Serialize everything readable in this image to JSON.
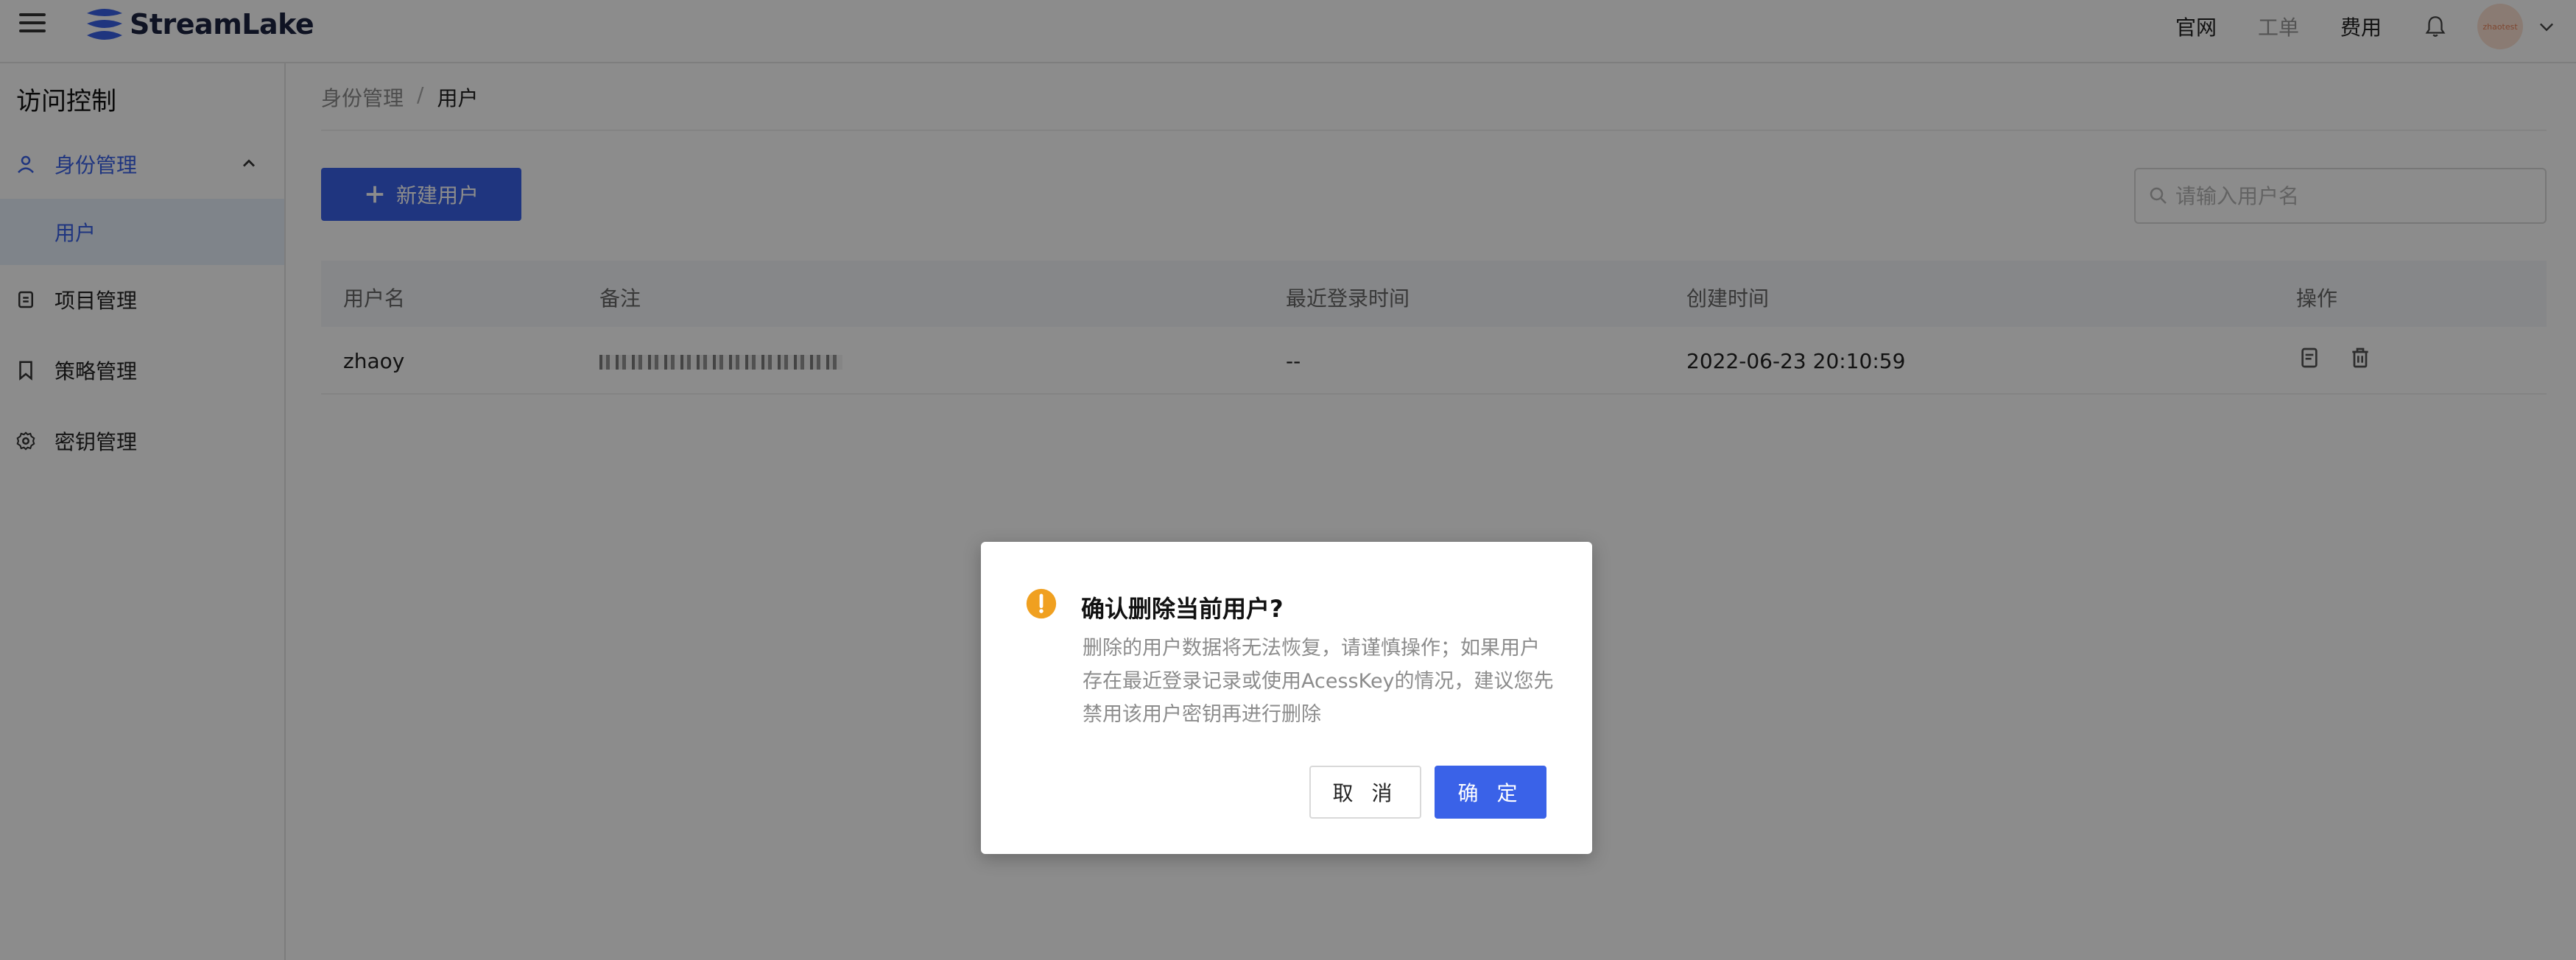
{
  "header": {
    "brand": "StreamLake",
    "nav": {
      "official": "官网",
      "ticket": "工单",
      "billing": "费用"
    },
    "avatar_text": "zhaotest"
  },
  "sidebar": {
    "title": "访问控制",
    "items": [
      {
        "label": "身份管理",
        "icon": "user-icon"
      },
      {
        "label": "用户"
      },
      {
        "label": "项目管理",
        "icon": "document-icon"
      },
      {
        "label": "策略管理",
        "icon": "bookmark-icon"
      },
      {
        "label": "密钥管理",
        "icon": "gear-icon"
      }
    ]
  },
  "breadcrumb": {
    "parent": "身份管理",
    "sep": "/",
    "current": "用户"
  },
  "toolbar": {
    "new_user": "新建用户",
    "search_placeholder": "请输入用户名"
  },
  "table": {
    "columns": [
      "用户名",
      "备注",
      "最近登录时间",
      "创建时间",
      "操作"
    ],
    "rows": [
      {
        "username": "zhaoy",
        "remark": "",
        "last_login": "--",
        "created": "2022-06-23 20:10:59"
      }
    ]
  },
  "modal": {
    "title": "确认删除当前用户?",
    "body": "删除的用户数据将无法恢复，请谨慎操作；如果用户存在最近登录记录或使用AcessKey的情况，建议您先禁用该用户密钥再进行删除",
    "cancel": "取 消",
    "confirm": "确 定"
  },
  "colors": {
    "primary": "#3a62e8",
    "warning": "#f0a020"
  }
}
